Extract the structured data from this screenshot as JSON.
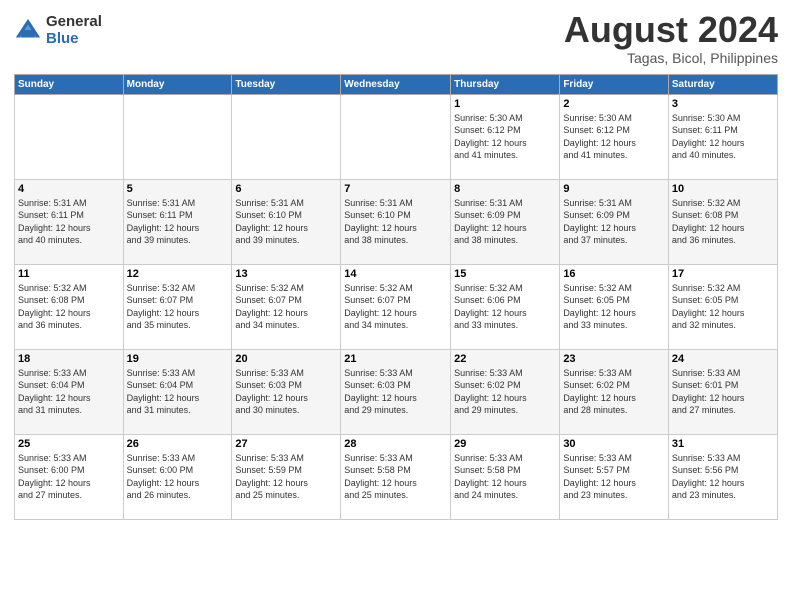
{
  "logo": {
    "general": "General",
    "blue": "Blue"
  },
  "title": "August 2024",
  "location": "Tagas, Bicol, Philippines",
  "days_header": [
    "Sunday",
    "Monday",
    "Tuesday",
    "Wednesday",
    "Thursday",
    "Friday",
    "Saturday"
  ],
  "weeks": [
    [
      {
        "day": "",
        "info": ""
      },
      {
        "day": "",
        "info": ""
      },
      {
        "day": "",
        "info": ""
      },
      {
        "day": "",
        "info": ""
      },
      {
        "day": "1",
        "info": "Sunrise: 5:30 AM\nSunset: 6:12 PM\nDaylight: 12 hours\nand 41 minutes."
      },
      {
        "day": "2",
        "info": "Sunrise: 5:30 AM\nSunset: 6:12 PM\nDaylight: 12 hours\nand 41 minutes."
      },
      {
        "day": "3",
        "info": "Sunrise: 5:30 AM\nSunset: 6:11 PM\nDaylight: 12 hours\nand 40 minutes."
      }
    ],
    [
      {
        "day": "4",
        "info": "Sunrise: 5:31 AM\nSunset: 6:11 PM\nDaylight: 12 hours\nand 40 minutes."
      },
      {
        "day": "5",
        "info": "Sunrise: 5:31 AM\nSunset: 6:11 PM\nDaylight: 12 hours\nand 39 minutes."
      },
      {
        "day": "6",
        "info": "Sunrise: 5:31 AM\nSunset: 6:10 PM\nDaylight: 12 hours\nand 39 minutes."
      },
      {
        "day": "7",
        "info": "Sunrise: 5:31 AM\nSunset: 6:10 PM\nDaylight: 12 hours\nand 38 minutes."
      },
      {
        "day": "8",
        "info": "Sunrise: 5:31 AM\nSunset: 6:09 PM\nDaylight: 12 hours\nand 38 minutes."
      },
      {
        "day": "9",
        "info": "Sunrise: 5:31 AM\nSunset: 6:09 PM\nDaylight: 12 hours\nand 37 minutes."
      },
      {
        "day": "10",
        "info": "Sunrise: 5:32 AM\nSunset: 6:08 PM\nDaylight: 12 hours\nand 36 minutes."
      }
    ],
    [
      {
        "day": "11",
        "info": "Sunrise: 5:32 AM\nSunset: 6:08 PM\nDaylight: 12 hours\nand 36 minutes."
      },
      {
        "day": "12",
        "info": "Sunrise: 5:32 AM\nSunset: 6:07 PM\nDaylight: 12 hours\nand 35 minutes."
      },
      {
        "day": "13",
        "info": "Sunrise: 5:32 AM\nSunset: 6:07 PM\nDaylight: 12 hours\nand 34 minutes."
      },
      {
        "day": "14",
        "info": "Sunrise: 5:32 AM\nSunset: 6:07 PM\nDaylight: 12 hours\nand 34 minutes."
      },
      {
        "day": "15",
        "info": "Sunrise: 5:32 AM\nSunset: 6:06 PM\nDaylight: 12 hours\nand 33 minutes."
      },
      {
        "day": "16",
        "info": "Sunrise: 5:32 AM\nSunset: 6:05 PM\nDaylight: 12 hours\nand 33 minutes."
      },
      {
        "day": "17",
        "info": "Sunrise: 5:32 AM\nSunset: 6:05 PM\nDaylight: 12 hours\nand 32 minutes."
      }
    ],
    [
      {
        "day": "18",
        "info": "Sunrise: 5:33 AM\nSunset: 6:04 PM\nDaylight: 12 hours\nand 31 minutes."
      },
      {
        "day": "19",
        "info": "Sunrise: 5:33 AM\nSunset: 6:04 PM\nDaylight: 12 hours\nand 31 minutes."
      },
      {
        "day": "20",
        "info": "Sunrise: 5:33 AM\nSunset: 6:03 PM\nDaylight: 12 hours\nand 30 minutes."
      },
      {
        "day": "21",
        "info": "Sunrise: 5:33 AM\nSunset: 6:03 PM\nDaylight: 12 hours\nand 29 minutes."
      },
      {
        "day": "22",
        "info": "Sunrise: 5:33 AM\nSunset: 6:02 PM\nDaylight: 12 hours\nand 29 minutes."
      },
      {
        "day": "23",
        "info": "Sunrise: 5:33 AM\nSunset: 6:02 PM\nDaylight: 12 hours\nand 28 minutes."
      },
      {
        "day": "24",
        "info": "Sunrise: 5:33 AM\nSunset: 6:01 PM\nDaylight: 12 hours\nand 27 minutes."
      }
    ],
    [
      {
        "day": "25",
        "info": "Sunrise: 5:33 AM\nSunset: 6:00 PM\nDaylight: 12 hours\nand 27 minutes."
      },
      {
        "day": "26",
        "info": "Sunrise: 5:33 AM\nSunset: 6:00 PM\nDaylight: 12 hours\nand 26 minutes."
      },
      {
        "day": "27",
        "info": "Sunrise: 5:33 AM\nSunset: 5:59 PM\nDaylight: 12 hours\nand 25 minutes."
      },
      {
        "day": "28",
        "info": "Sunrise: 5:33 AM\nSunset: 5:58 PM\nDaylight: 12 hours\nand 25 minutes."
      },
      {
        "day": "29",
        "info": "Sunrise: 5:33 AM\nSunset: 5:58 PM\nDaylight: 12 hours\nand 24 minutes."
      },
      {
        "day": "30",
        "info": "Sunrise: 5:33 AM\nSunset: 5:57 PM\nDaylight: 12 hours\nand 23 minutes."
      },
      {
        "day": "31",
        "info": "Sunrise: 5:33 AM\nSunset: 5:56 PM\nDaylight: 12 hours\nand 23 minutes."
      }
    ]
  ]
}
